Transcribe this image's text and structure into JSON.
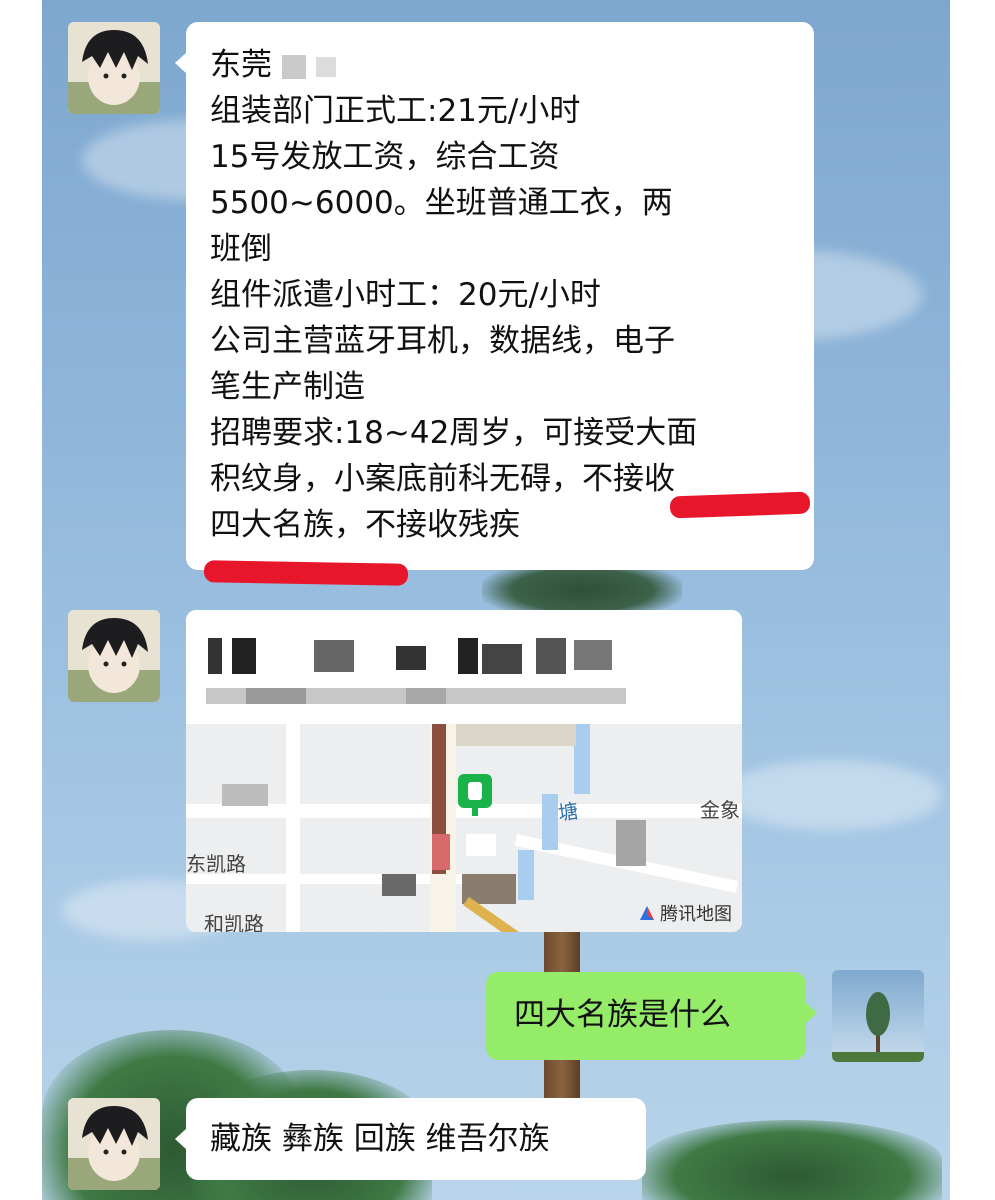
{
  "messages": [
    {
      "side": "left",
      "lines": [
        "东莞",
        "组装部门正式工:21元/小时",
        "15号发放工资，综合工资",
        "5500~6000。坐班普通工衣，两",
        "班倒",
        "组件派遣小时工：20元/小时",
        "公司主营蓝牙耳机，数据线，电子",
        "笔生产制造",
        "招聘要求:18~42周岁，可接受大面",
        "积纹身，小案底前科无碍，不接收",
        "四大名族，不接收残疾"
      ]
    },
    {
      "side": "left",
      "type": "location",
      "map_labels": {
        "road_left": "东凯路",
        "road_bottom": "和凯路",
        "river": "塘",
        "place": "金象",
        "watermark": "腾讯地图"
      }
    },
    {
      "side": "right",
      "text": "四大名族是什么"
    },
    {
      "side": "left",
      "text": "藏族 彝族 回族 维吾尔族"
    }
  ],
  "colors": {
    "green_bubble": "#95ec69",
    "underline": "#e8162b",
    "map_pin": "#19b34a"
  },
  "icons": {
    "map_pin": "location-pin-icon",
    "watermark": "tencent-map-logo-icon"
  }
}
